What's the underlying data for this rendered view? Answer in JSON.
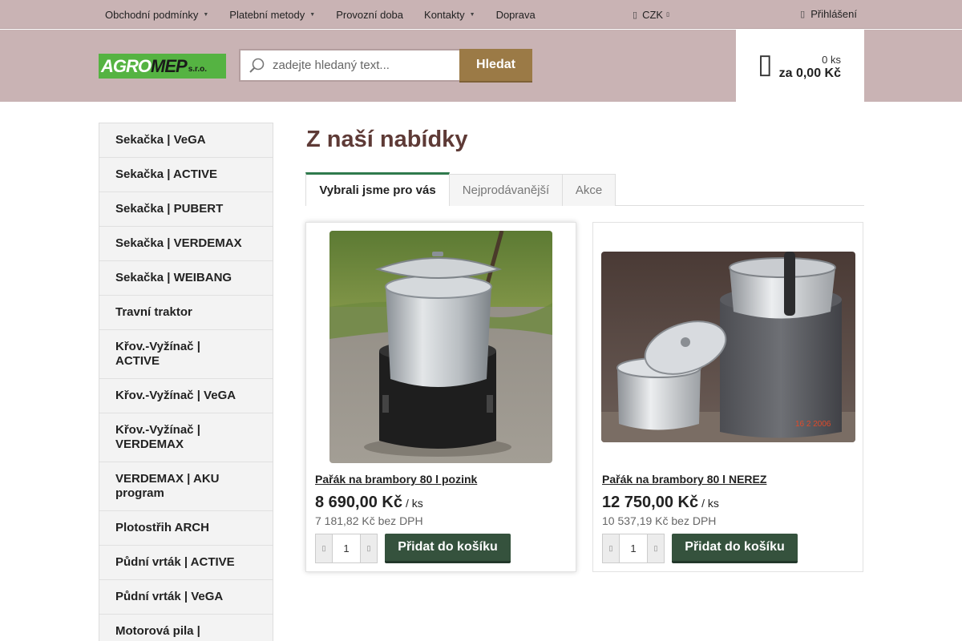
{
  "topnav": {
    "items": [
      {
        "label": "Obchodní podmínky",
        "has_caret": true
      },
      {
        "label": "Platební metody",
        "has_caret": true
      },
      {
        "label": "Provozní doba",
        "has_caret": false
      },
      {
        "label": "Kontakty",
        "has_caret": true
      },
      {
        "label": "Doprava",
        "has_caret": false
      }
    ],
    "currency": "CZK",
    "login": "Přihlášení"
  },
  "header": {
    "logo": {
      "part1": "AGRO",
      "part2": "MEP",
      "suffix": "s.r.o."
    },
    "search": {
      "placeholder": "zadejte hledaný text...",
      "button": "Hledat"
    },
    "cart": {
      "quantity": "0 ks",
      "total": "za 0,00 Kč"
    }
  },
  "sidebar": {
    "items": [
      "Sekačka | VeGA",
      "Sekačka | ACTIVE",
      "Sekačka | PUBERT",
      "Sekačka | VERDEMAX",
      "Sekačka | WEIBANG",
      "Travní traktor",
      "Křov.-Vyžínač | ACTIVE",
      "Křov.-Vyžínač | VeGA",
      "Křov.-Vyžínač | VERDEMAX",
      "VERDEMAX | AKU program",
      "Plotostřih ARCH",
      "Půdní vrták | ACTIVE",
      "Půdní vrták | VeGA",
      "Motorová pila |"
    ]
  },
  "main": {
    "title": "Z naší nabídky",
    "tabs": [
      {
        "label": "Vybrali jsme pro vás",
        "active": true
      },
      {
        "label": "Nejprodávanější",
        "active": false
      },
      {
        "label": "Akce",
        "active": false
      }
    ],
    "products": [
      {
        "name": "Pařák na brambory 80 l pozink",
        "price": "8 690,00 Kč",
        "unit": "/ ks",
        "price_net": "7 181,82 Kč bez DPH",
        "quantity": "1",
        "add_label": "Přidat do košíku"
      },
      {
        "name": "Pařák na brambory 80 l NEREZ",
        "price": "12 750,00 Kč",
        "unit": "/ ks",
        "price_net": "10 537,19 Kč bez DPH",
        "quantity": "1",
        "add_label": "Přidat do košíku",
        "photo_stamp": "16 2 2006"
      }
    ]
  },
  "colors": {
    "header_bg": "#c9b3b4",
    "search_button": "#9b7a46",
    "title": "#5e3a36",
    "active_tab_border": "#2f7a4d",
    "add_button": "#35523d",
    "logo_green": "#55b342"
  },
  "icons": {
    "search": "magnifier-icon",
    "cart": "shopping-cart-icon",
    "login": "user-icon",
    "currency": "coins-icon",
    "decrement": "minus-icon",
    "increment": "plus-icon"
  }
}
